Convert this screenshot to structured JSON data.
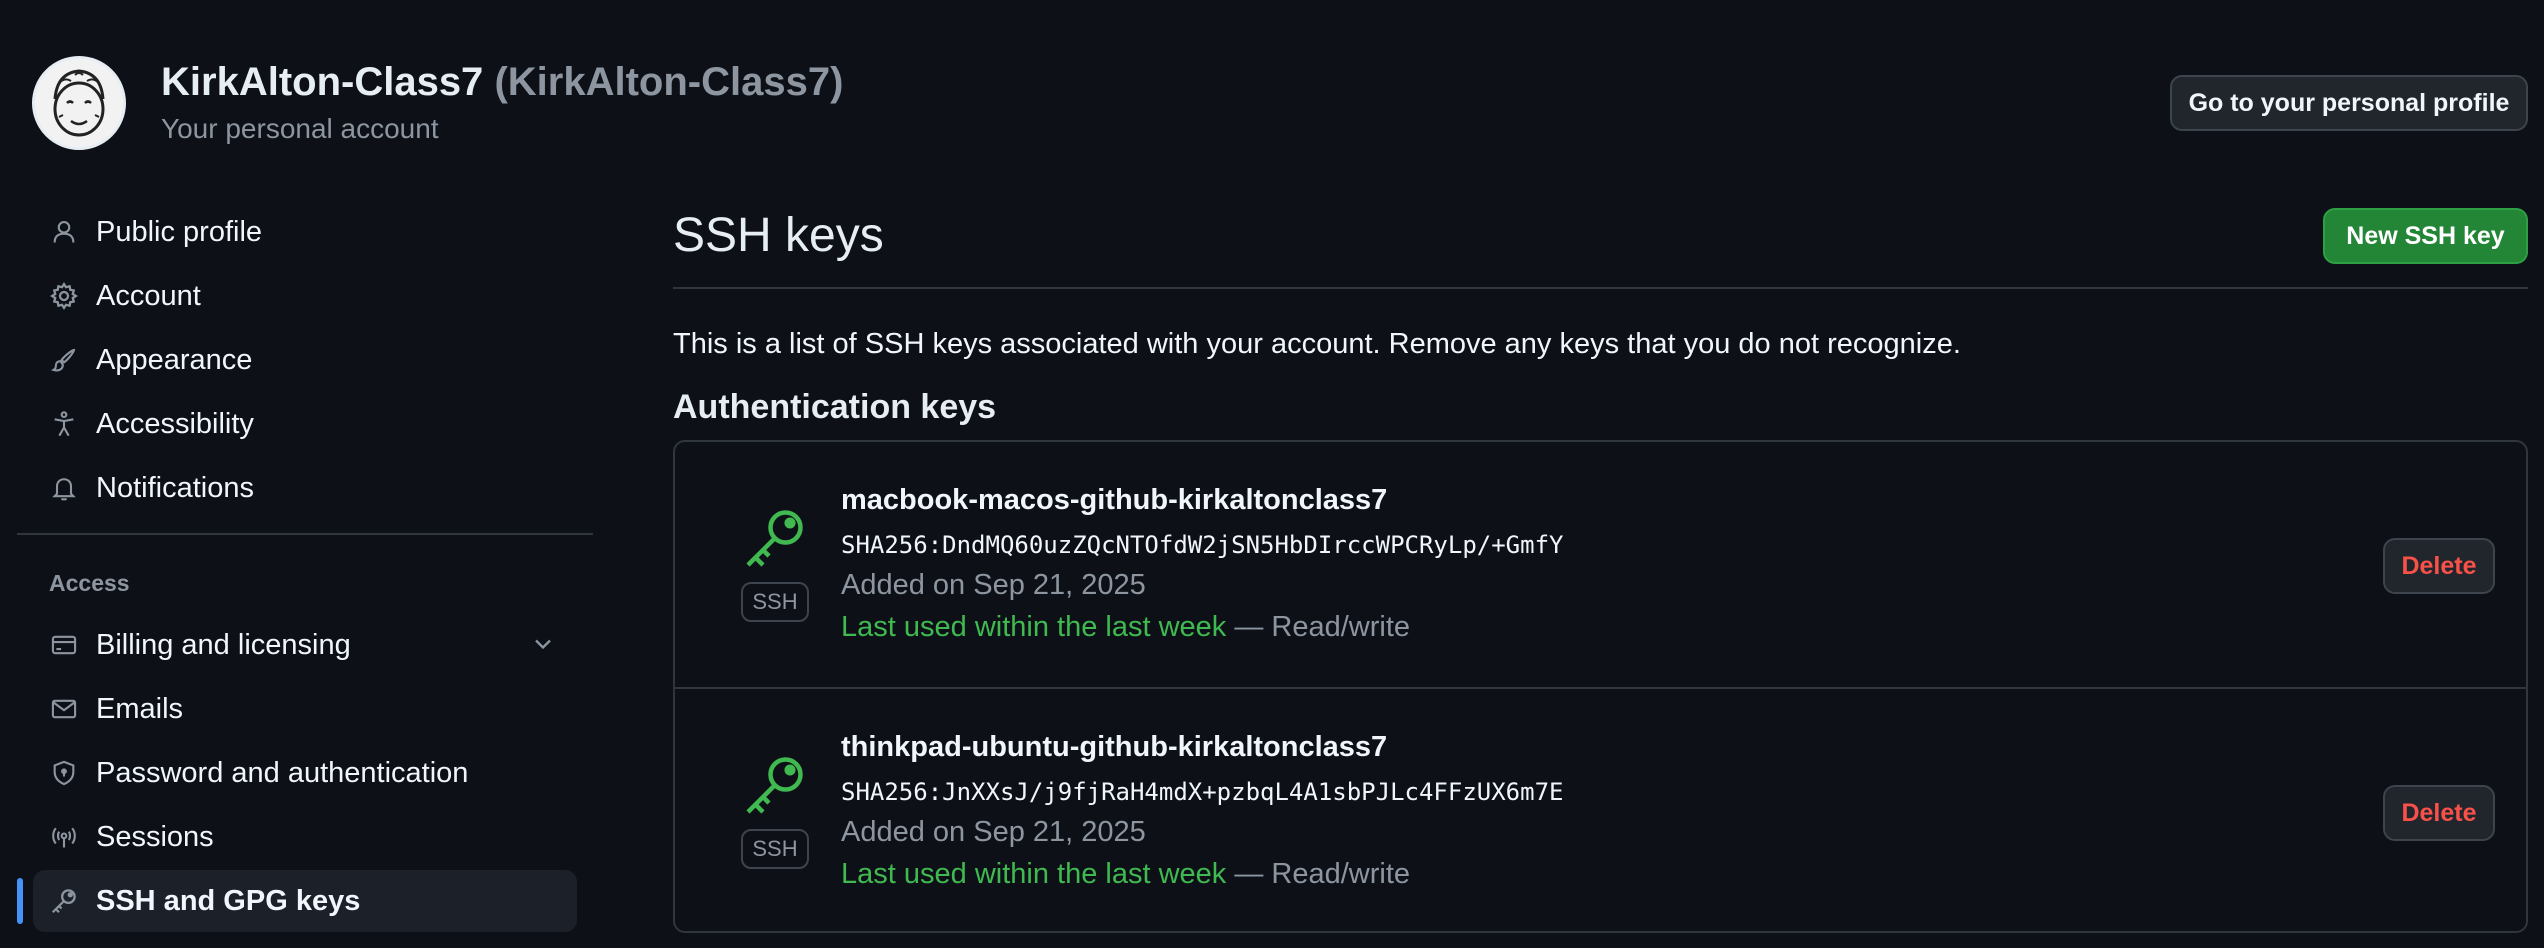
{
  "account": {
    "name": "KirkAlton-Class7",
    "login": "(KirkAlton-Class7)",
    "subtitle": "Your personal account",
    "profile_button": "Go to your personal profile"
  },
  "sidebar": {
    "items": [
      {
        "label": "Public profile",
        "icon": "person-icon"
      },
      {
        "label": "Account",
        "icon": "gear-icon"
      },
      {
        "label": "Appearance",
        "icon": "paintbrush-icon"
      },
      {
        "label": "Accessibility",
        "icon": "accessibility-icon"
      },
      {
        "label": "Notifications",
        "icon": "bell-icon"
      }
    ],
    "access_section": "Access",
    "access_items": [
      {
        "label": "Billing and licensing",
        "icon": "credit-card-icon"
      },
      {
        "label": "Emails",
        "icon": "mail-icon"
      },
      {
        "label": "Password and authentication",
        "icon": "shield-lock-icon"
      },
      {
        "label": "Sessions",
        "icon": "broadcast-icon"
      },
      {
        "label": "SSH and GPG keys",
        "icon": "key-icon",
        "active": true
      }
    ]
  },
  "main": {
    "title": "SSH keys",
    "new_button": "New SSH key",
    "description": "This is a list of SSH keys associated with your account. Remove any keys that you do not recognize.",
    "section_title": "Authentication keys",
    "keys": [
      {
        "badge": "SSH",
        "name": "macbook-macos-github-kirkaltonclass7",
        "fingerprint": "SHA256:DndMQ60uzZQcNTOfdW2jSN5HbDIrccWPCRyLp/+GmfY",
        "added": "Added on Sep 21, 2025",
        "last_used": "Last used within the last week",
        "access": " — Read/write",
        "delete_label": "Delete"
      },
      {
        "badge": "SSH",
        "name": "thinkpad-ubuntu-github-kirkaltonclass7",
        "fingerprint": "SHA256:JnXXsJ/j9fjRaH4mdX+pzbqL4A1sbPJLc4FFzUX6m7E",
        "added": "Added on Sep 21, 2025",
        "last_used": "Last used within the last week",
        "access": " — Read/write",
        "delete_label": "Delete"
      }
    ]
  },
  "colors": {
    "background": "#0d1117",
    "primary_button": "#238636",
    "success_text": "#3fb950",
    "danger_text": "#f85149",
    "active_indicator": "#4493f8"
  }
}
